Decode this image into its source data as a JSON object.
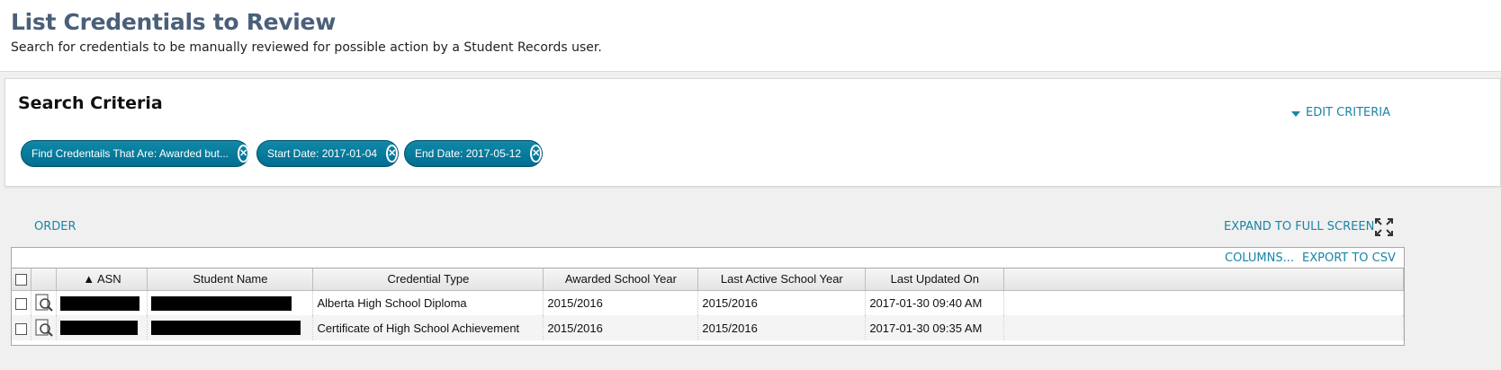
{
  "page": {
    "title": "List Credentials to Review",
    "subtitle": "Search for credentials to be manually reviewed for possible action by a Student Records user."
  },
  "criteria": {
    "title": "Search Criteria",
    "edit_label": "EDIT CRITERIA",
    "chips": [
      {
        "label": "Find Credentails That Are: Awarded but..."
      },
      {
        "label": "Start Date: 2017-01-04"
      },
      {
        "label": "End Date: 2017-05-12"
      }
    ]
  },
  "toolbar": {
    "order_label": "ORDER",
    "expand_label": "EXPAND TO FULL SCREEN",
    "columns_label": "COLUMNS...",
    "export_label": "EXPORT TO CSV"
  },
  "grid": {
    "columns": [
      "▲ ASN",
      "Student Name",
      "Credential Type",
      "Awarded School Year",
      "Last Active School Year",
      "Last Updated On"
    ],
    "rows": [
      {
        "credential_type": "Alberta High School Diploma",
        "awarded_year": "2015/2016",
        "last_active_year": "2015/2016",
        "updated_on": "2017-01-30 09:40 AM"
      },
      {
        "credential_type": "Certificate of High School Achievement",
        "awarded_year": "2015/2016",
        "last_active_year": "2015/2016",
        "updated_on": "2017-01-30 09:35 AM"
      }
    ]
  },
  "icons": {
    "chip_remove": "close-circle-icon",
    "edit_caret": "caret-down-icon",
    "expand": "expand-arrows-icon",
    "row_review": "search-document-icon"
  },
  "colors": {
    "accent": "#1a84a8",
    "chip_bg": "#00789a",
    "title": "#4a5f7a"
  }
}
